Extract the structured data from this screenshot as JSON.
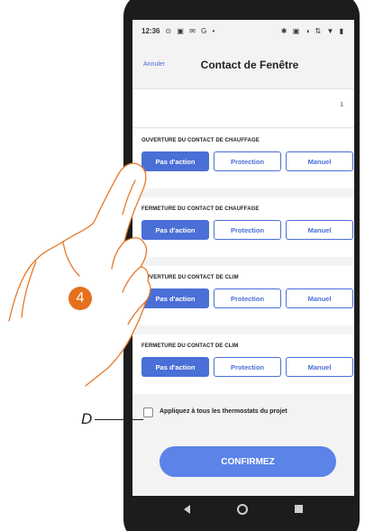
{
  "status_bar": {
    "time": "12:36",
    "left_icons": "⊙ ▣ ✉ G •",
    "right_icons": "✱ ▣ ◑ ⇅ ▼ ▮"
  },
  "window_icons": {
    "edit": "external-edit-icon",
    "close": "close-icon"
  },
  "header": {
    "cancel_label": "Annuler",
    "title": "Contact de Fenêtre"
  },
  "pager": {
    "page": "1"
  },
  "sections": [
    {
      "label": "OUVERTURE DU CONTACT DE CHAUFFAGE",
      "options": [
        "Pas d'action",
        "Protection",
        "Manuel"
      ],
      "selected": "Pas d'action"
    },
    {
      "label": "FERMETURE DU CONTACT DE CHAUFFAGE",
      "options": [
        "Pas d'action",
        "Protection",
        "Manuel"
      ],
      "selected": "Pas d'action"
    },
    {
      "label": "OUVERTURE DU CONTACT DE CLIM",
      "options": [
        "Pas d'action",
        "Protection",
        "Manuel"
      ],
      "selected": "Pas d'action"
    },
    {
      "label": "FERMETURE DU CONTACT DE CLIM",
      "options": [
        "Pas d'action",
        "Protection",
        "Manuel"
      ],
      "selected": "Pas d'action"
    }
  ],
  "apply_all": {
    "label": "Appliquez à tous les thermostats du projet",
    "checked": false
  },
  "confirm_label": "CONFIRMEZ",
  "annotations": {
    "step_marker": "4",
    "callout": "D"
  },
  "colors": {
    "accent": "#4a6fd6",
    "confirm": "#5b83e8",
    "marker": "#e5701d"
  }
}
